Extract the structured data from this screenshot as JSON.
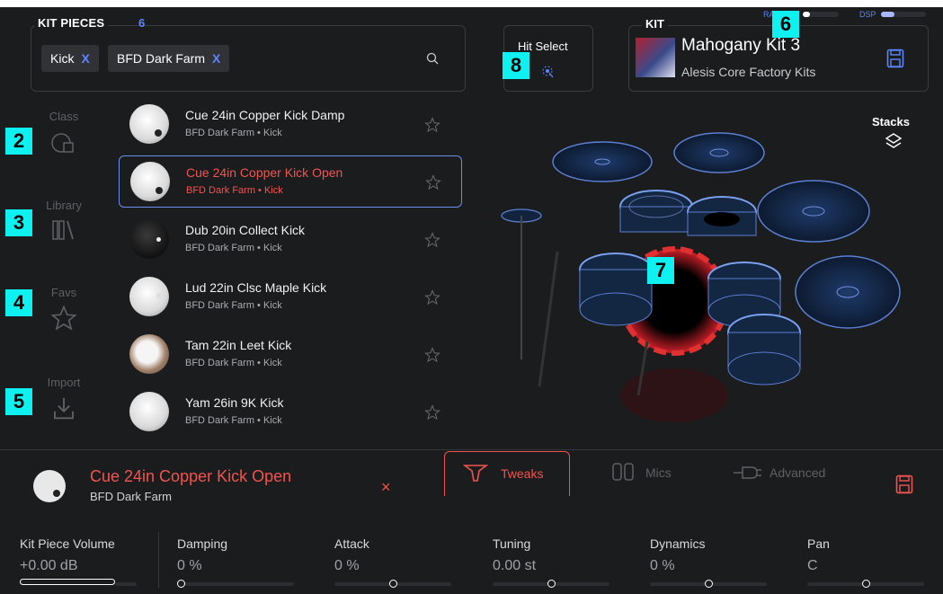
{
  "kit_pieces": {
    "header": "KIT PIECES",
    "count": "6",
    "filters": [
      {
        "label": "Kick",
        "remove": "X"
      },
      {
        "label": "BFD Dark Farm",
        "remove": "X"
      }
    ]
  },
  "rail": {
    "class_label": "Class",
    "library_label": "Library",
    "favs_label": "Favs",
    "import_label": "Import"
  },
  "badges": [
    "2",
    "3",
    "4",
    "5",
    "6",
    "7",
    "8"
  ],
  "list": [
    {
      "name": "Cue 24in Copper Kick Damp",
      "sub": "BFD Dark Farm • Kick"
    },
    {
      "name": "Cue 24in Copper Kick Open",
      "sub": "BFD Dark Farm • Kick"
    },
    {
      "name": "Dub 20in Collect Kick",
      "sub": "BFD Dark Farm • Kick"
    },
    {
      "name": "Lud 22in Clsc Maple Kick",
      "sub": "BFD Dark Farm • Kick"
    },
    {
      "name": "Tam 22in Leet Kick",
      "sub": "BFD Dark Farm • Kick"
    },
    {
      "name": "Yam 26in 9K Kick",
      "sub": "BFD Dark Farm • Kick"
    }
  ],
  "hit_select": {
    "label": "Hit Select"
  },
  "kit": {
    "header": "KIT",
    "name": "Mahogany Kit 3",
    "library": "Alesis Core Factory Kits"
  },
  "meters": {
    "ram_label": "RA",
    "dsp_label": "DSP",
    "ram_level": 0.2,
    "dsp_level": 0.3
  },
  "stacks": {
    "label": "Stacks"
  },
  "selected": {
    "name": "Cue 24in Copper Kick Open",
    "library": "BFD Dark Farm",
    "close": "×"
  },
  "tabs": [
    {
      "label": "Tweaks"
    },
    {
      "label": "Mics"
    },
    {
      "label": "Advanced"
    }
  ],
  "params": [
    {
      "name": "Kit Piece Volume",
      "value": "+0.00 dB"
    },
    {
      "name": "Damping",
      "value": "0 %"
    },
    {
      "name": "Attack",
      "value": "0 %"
    },
    {
      "name": "Tuning",
      "value": "0.00 st"
    },
    {
      "name": "Dynamics",
      "value": "0 %"
    },
    {
      "name": "Pan",
      "value": "C"
    }
  ],
  "colors": {
    "accent": "#f0544f",
    "blue": "#5b86ff",
    "badge": "#0ff0f0",
    "bg": "#1b1c1e"
  }
}
